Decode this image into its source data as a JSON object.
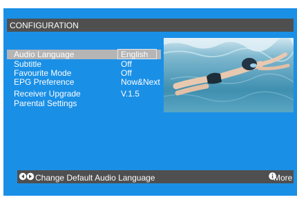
{
  "header": {
    "title": "CONFIGURATION"
  },
  "menu": {
    "items": [
      {
        "label": "Audio Language",
        "value": "English",
        "selected": true
      },
      {
        "label": "Subtitle",
        "value": "Off"
      },
      {
        "label": "Favourite Mode",
        "value": "Off"
      },
      {
        "label": "EPG Preference",
        "value": "Now&Next"
      },
      {
        "label": "Receiver Upgrade",
        "value": "V.1.5"
      },
      {
        "label": "Parental Settings",
        "value": ""
      }
    ]
  },
  "footer": {
    "hint": "Change Default Audio Language",
    "more_label": "More"
  },
  "colors": {
    "screen_background": "#1a8fe6",
    "bar": "#4f4f4f",
    "selection": "#b5b5b5"
  },
  "icons": {
    "navigation": "left-right-arrows-icon",
    "info": "info-icon"
  }
}
